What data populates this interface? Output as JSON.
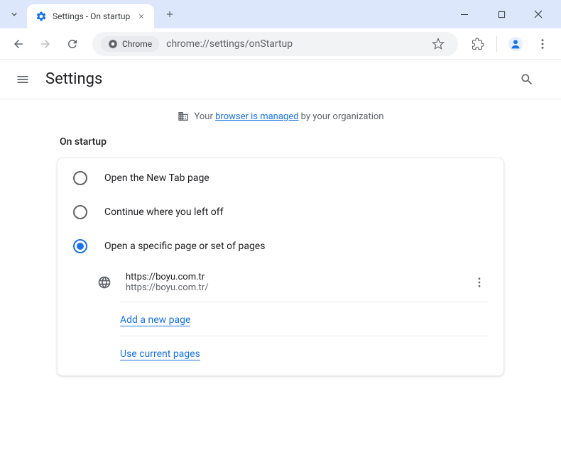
{
  "tab": {
    "title": "Settings - On startup"
  },
  "omnibox": {
    "site_label": "Chrome",
    "url": "chrome://settings/onStartup"
  },
  "header": {
    "title": "Settings"
  },
  "managed": {
    "prefix": "Your ",
    "link": "browser is managed",
    "suffix": " by your organization"
  },
  "section": {
    "title": "On startup",
    "options": [
      {
        "label": "Open the New Tab page",
        "selected": false
      },
      {
        "label": "Continue where you left off",
        "selected": false
      },
      {
        "label": "Open a specific page or set of pages",
        "selected": true
      }
    ],
    "page": {
      "name": "https://boyu.com.tr",
      "url": "https://boyu.com.tr/"
    },
    "add_link": "Add a new page",
    "use_current_link": "Use current pages"
  }
}
